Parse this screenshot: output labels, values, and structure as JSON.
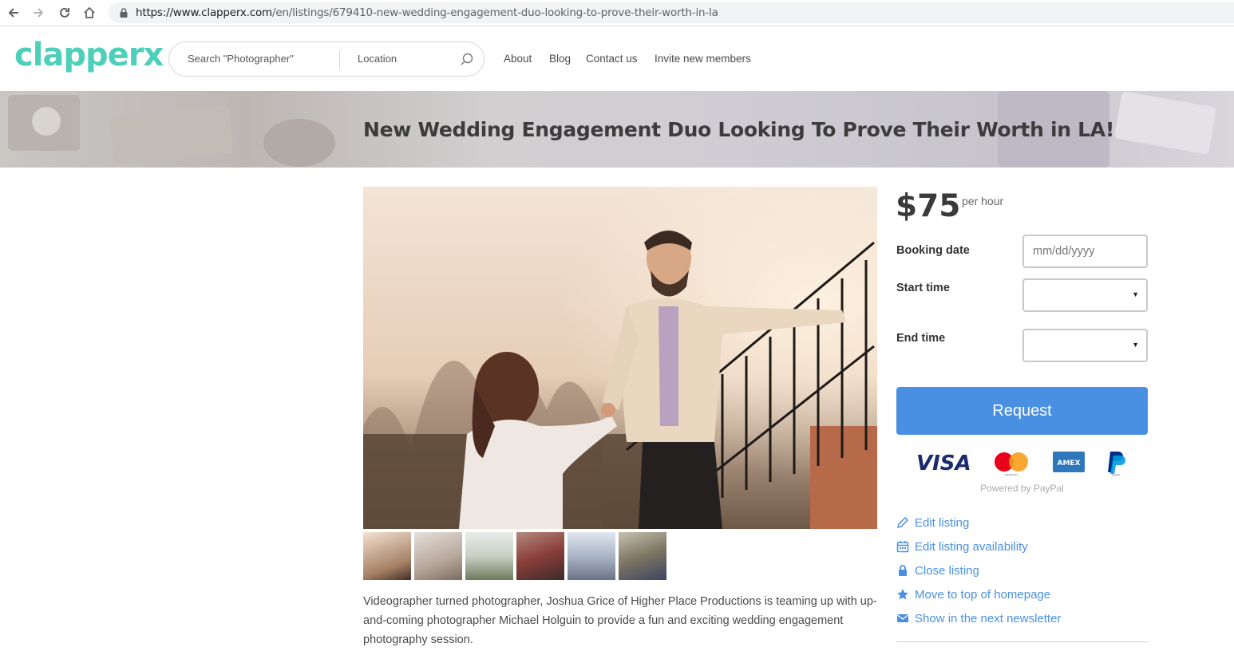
{
  "browser": {
    "url_host": "https://www.clapperx.com",
    "url_path": "/en/listings/679410-new-wedding-engagement-duo-looking-to-prove-their-worth-in-la"
  },
  "header": {
    "logo": "clapperx",
    "search_placeholder": "Search \"Photographer\"",
    "location_placeholder": "Location",
    "nav": [
      "About",
      "Blog",
      "Contact us",
      "Invite new members"
    ]
  },
  "listing": {
    "title": "New Wedding Engagement Duo Looking To Prove Their Worth in LA!",
    "description": "Videographer turned photographer, Joshua Grice of Higher Place Productions is teaming up with up-and-coming photographer Michael Holguin to provide a fun and exciting wedding engagement photography session."
  },
  "booking": {
    "price": "$75",
    "price_unit": "per hour",
    "booking_date_label": "Booking date",
    "date_placeholder": "mm/dd/yyyy",
    "start_time_label": "Start time",
    "end_time_label": "End time",
    "request_label": "Request",
    "powered_by": "Powered by PayPal",
    "card_brands": [
      "VISA",
      "mastercard",
      "AMEX",
      "paypal"
    ]
  },
  "actions": [
    {
      "icon": "pencil-icon",
      "label": "Edit listing"
    },
    {
      "icon": "calendar-icon",
      "label": "Edit listing availability"
    },
    {
      "icon": "lock-icon",
      "label": "Close listing"
    },
    {
      "icon": "star-icon",
      "label": "Move to top of homepage"
    },
    {
      "icon": "envelope-icon",
      "label": "Show in the next newsletter"
    }
  ],
  "colors": {
    "brand": "#4ecfba",
    "link": "#4a90e2",
    "button": "#4a90e2"
  }
}
